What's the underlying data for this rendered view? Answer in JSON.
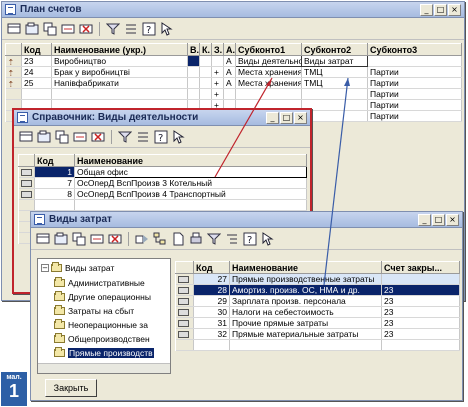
{
  "main_window": {
    "title": "План счетов",
    "columns": [
      "Код",
      "Наименование (укр.)",
      "В.",
      "К.",
      "З.",
      "А.",
      "Субконто1",
      "Субконто2",
      "Субконто3"
    ],
    "rows": [
      {
        "code": "23",
        "name": "Виробництво",
        "v": "",
        "k": "",
        "z": "",
        "a": "А",
        "s1": "Виды деятельно",
        "s2": "Виды затрат",
        "s3": ""
      },
      {
        "code": "24",
        "name": "Брак у виробництві",
        "v": "",
        "k": "",
        "z": "+",
        "a": "А",
        "s1": "Места хранения",
        "s2": "ТМЦ",
        "s3": "Партии"
      },
      {
        "code": "25",
        "name": "Напівфабрикати",
        "v": "",
        "k": "",
        "z": "+",
        "a": "А",
        "s1": "Места хранения",
        "s2": "ТМЦ",
        "s3": "Партии"
      },
      {
        "code": "",
        "name": "",
        "v": "",
        "k": "",
        "z": "+",
        "a": "",
        "s1": "",
        "s2": "",
        "s3": "Партии"
      },
      {
        "code": "",
        "name": "",
        "v": "",
        "k": "",
        "z": "+",
        "a": "",
        "s1": "",
        "s2": "",
        "s3": "Партии"
      },
      {
        "code": "",
        "name": "",
        "v": "",
        "k": "",
        "z": "+",
        "a": "",
        "s1": "",
        "s2": "",
        "s3": "Партии"
      }
    ]
  },
  "activities_window": {
    "title": "Справочник: Виды деятельности",
    "columns": [
      "Код",
      "Наименование"
    ],
    "rows": [
      {
        "code": "1",
        "name": "Общая офис"
      },
      {
        "code": "7",
        "name": "ОсОперД ВспПроизв 3 Котельный"
      },
      {
        "code": "8",
        "name": "ОсОперД ВспПроизв 4 Транспортный"
      }
    ]
  },
  "costs_window": {
    "title": "Виды затрат",
    "tree_root": "Виды затрат",
    "tree_items": [
      "Административные",
      "Другие операционны",
      "Затраты на сбыт",
      "Неоперационные за",
      "Общепроизводствен",
      "Прямые производств"
    ],
    "columns": [
      "Код",
      "Наименование",
      "Счет закры..."
    ],
    "rows": [
      {
        "code": "27",
        "name": "Прямые производственные затраты",
        "acct": ""
      },
      {
        "code": "28",
        "name": "Амортиз. произв. ОС, НМА и др.",
        "acct": "23"
      },
      {
        "code": "29",
        "name": "Зарплата произв. персонала",
        "acct": "23"
      },
      {
        "code": "30",
        "name": "Налоги на себестоимость",
        "acct": "23"
      },
      {
        "code": "31",
        "name": "Прочие прямые затраты",
        "acct": "23"
      },
      {
        "code": "32",
        "name": "Прямые материальные затраты",
        "acct": "23"
      }
    ],
    "close_label": "Закрыть"
  },
  "badge": {
    "top": "мал.",
    "num": "1"
  },
  "colors": {
    "accent_red": "#c0242c",
    "link_blue": "#3a5da8",
    "selection": "#0a246a"
  }
}
